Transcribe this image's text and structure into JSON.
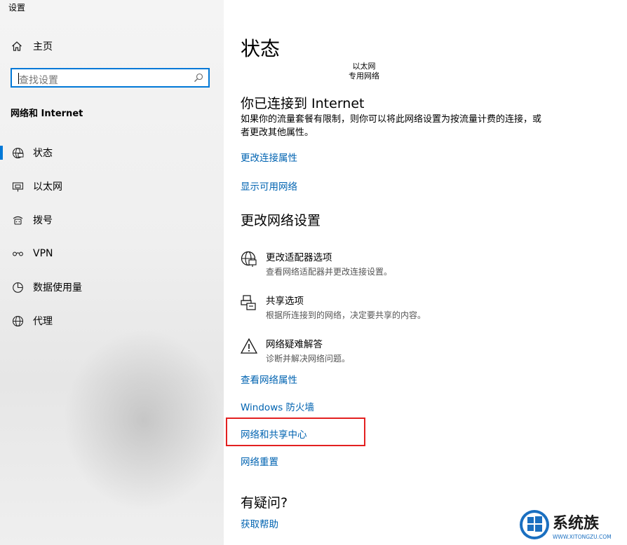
{
  "window": {
    "title": "设置"
  },
  "sidebar": {
    "home_label": "主页",
    "search_placeholder": "查找设置",
    "section_label": "网络和 Internet",
    "items": [
      {
        "label": "状态",
        "icon": "globe-status-icon",
        "active": true
      },
      {
        "label": "以太网",
        "icon": "ethernet-icon"
      },
      {
        "label": "拨号",
        "icon": "dialup-icon"
      },
      {
        "label": "VPN",
        "icon": "vpn-icon"
      },
      {
        "label": "数据使用量",
        "icon": "data-usage-icon"
      },
      {
        "label": "代理",
        "icon": "proxy-globe-icon"
      }
    ]
  },
  "main": {
    "title": "状态",
    "network_name": "以太网",
    "network_type": "专用网络",
    "connected_heading": "你已连接到 Internet",
    "connected_desc": "如果你的流量套餐有限制，则你可以将此网络设置为按流量计费的连接，或者更改其他属性。",
    "link_change_props": "更改连接属性",
    "link_show_networks": "显示可用网络",
    "change_heading": "更改网络设置",
    "options": [
      {
        "title": "更改适配器选项",
        "subtitle": "查看网络适配器并更改连接设置。",
        "icon": "adapter-globe-icon"
      },
      {
        "title": "共享选项",
        "subtitle": "根据所连接到的网络，决定要共享的内容。",
        "icon": "sharing-icon"
      },
      {
        "title": "网络疑难解答",
        "subtitle": "诊断并解决网络问题。",
        "icon": "warning-icon"
      }
    ],
    "links": [
      "查看网络属性",
      "Windows 防火墙",
      "网络和共享中心",
      "网络重置"
    ],
    "question_heading": "有疑问?",
    "help_link": "获取帮助"
  },
  "watermark": {
    "text": "系统族",
    "url": "WWW.XITONGZU.COM"
  },
  "colors": {
    "accent": "#0078d7",
    "link": "#0063b1",
    "highlight": "#e32020"
  }
}
